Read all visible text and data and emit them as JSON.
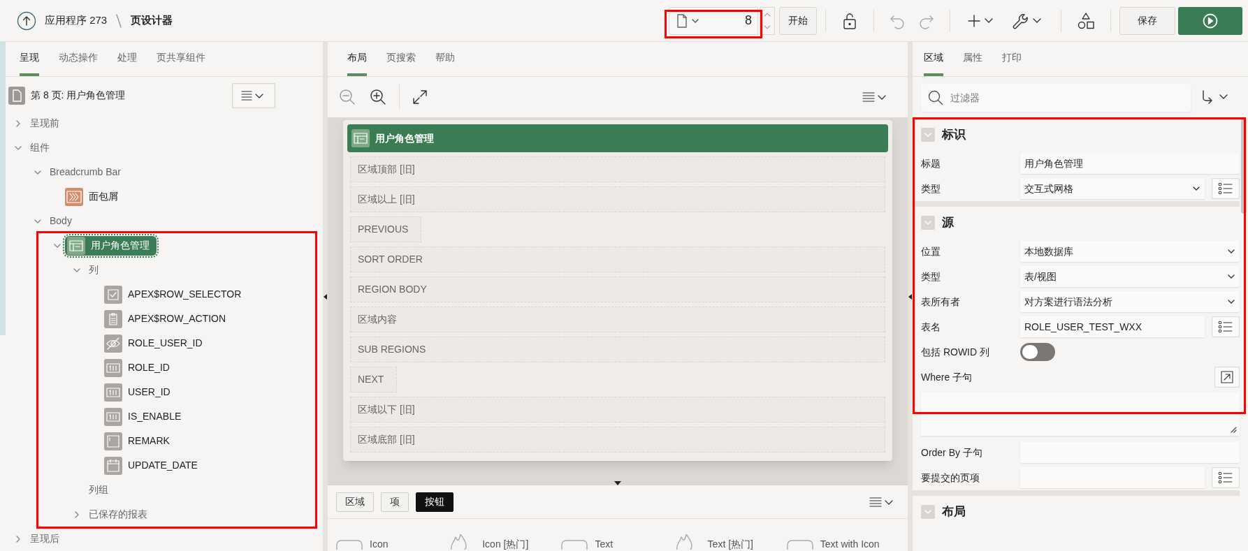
{
  "header": {
    "breadcrumb": [
      "应用程序 273",
      "页设计器"
    ],
    "page_selector": {
      "value": "8",
      "highlighted": true
    },
    "start_button": "开始",
    "save_button": "保存"
  },
  "left_panel": {
    "tabs": [
      {
        "label": "呈现",
        "selected": true
      },
      {
        "label": "动态操作",
        "selected": false
      },
      {
        "label": "处理",
        "selected": false
      },
      {
        "label": "页共享组件",
        "selected": false
      }
    ],
    "page_title": "第 8 页: 用户角色管理",
    "tree": [
      {
        "label": "呈现前",
        "expanded": false
      },
      {
        "label": "组件",
        "expanded": true,
        "children": [
          {
            "label": "Breadcrumb Bar",
            "expanded": true,
            "children": [
              {
                "label": "面包屑",
                "kind": "breadcrumb"
              }
            ]
          },
          {
            "label": "Body",
            "expanded": true,
            "children": [
              {
                "label": "用户角色管理",
                "kind": "region",
                "expanded": true,
                "selected": true,
                "highlighted": true,
                "children": [
                  {
                    "label": "列",
                    "expanded": true,
                    "children": [
                      {
                        "label": "APEX$ROW_SELECTOR",
                        "kind": "checkbox"
                      },
                      {
                        "label": "APEX$ROW_ACTION",
                        "kind": "action"
                      },
                      {
                        "label": "ROLE_USER_ID",
                        "kind": "hidden"
                      },
                      {
                        "label": "ROLE_ID",
                        "kind": "number"
                      },
                      {
                        "label": "USER_ID",
                        "kind": "number"
                      },
                      {
                        "label": "IS_ENABLE",
                        "kind": "number"
                      },
                      {
                        "label": "REMARK",
                        "kind": "text"
                      },
                      {
                        "label": "UPDATE_DATE",
                        "kind": "date"
                      }
                    ]
                  },
                  {
                    "label": "列组"
                  },
                  {
                    "label": "已保存的报表",
                    "expanded": false
                  }
                ]
              }
            ]
          }
        ]
      },
      {
        "label": "呈现后",
        "expanded": false
      }
    ]
  },
  "center_panel": {
    "tabs": [
      {
        "label": "布局",
        "selected": true
      },
      {
        "label": "页搜索",
        "selected": false
      },
      {
        "label": "帮助",
        "selected": false
      }
    ],
    "region_title": "用户角色管理",
    "slots": [
      {
        "label": "区域顶部 [旧]",
        "kind": "wide"
      },
      {
        "label": "区域以上 [旧]",
        "kind": "wide"
      },
      {
        "label": "PREVIOUS",
        "kind": "narrow"
      },
      {
        "label": "SORT ORDER",
        "kind": "wide"
      },
      {
        "label": "REGION BODY",
        "kind": "wide"
      },
      {
        "label": "区域内容",
        "kind": "wide"
      },
      {
        "label": "SUB REGIONS",
        "kind": "wide"
      },
      {
        "label": "NEXT",
        "kind": "narrow"
      },
      {
        "label": "区域以下 [旧]",
        "kind": "wide"
      },
      {
        "label": "区域底部 [旧]",
        "kind": "wide"
      }
    ],
    "gallery_tabs": [
      {
        "label": "区域",
        "selected": false
      },
      {
        "label": "项",
        "selected": false
      },
      {
        "label": "按钮",
        "selected": true
      }
    ],
    "gallery_items": [
      {
        "label": "Icon",
        "hot": false
      },
      {
        "label": "Icon [热门]",
        "hot": true
      },
      {
        "label": "Text",
        "hot": false
      },
      {
        "label": "Text [热门]",
        "hot": true
      },
      {
        "label": "Text with Icon",
        "hot": false
      }
    ]
  },
  "right_panel": {
    "tabs": [
      {
        "label": "区域",
        "selected": true
      },
      {
        "label": "属性",
        "selected": false
      },
      {
        "label": "打印",
        "selected": false
      }
    ],
    "filter": {
      "placeholder": "过滤器"
    },
    "sections": [
      {
        "title": "标识",
        "expanded": true,
        "properties": [
          {
            "label": "标题",
            "kind": "text",
            "value": "用户角色管理"
          },
          {
            "label": "类型",
            "kind": "select-lov",
            "value": "交互式网格"
          }
        ]
      },
      {
        "title": "源",
        "expanded": true,
        "properties": [
          {
            "label": "位置",
            "kind": "select",
            "value": "本地数据库"
          },
          {
            "label": "类型",
            "kind": "select",
            "value": "表/视图"
          },
          {
            "label": "表所有者",
            "kind": "select",
            "value": "对方案进行语法分析"
          },
          {
            "label": "表名",
            "kind": "text-lov",
            "value": "ROLE_USER_TEST_WXX"
          },
          {
            "label": "包括 ROWID 列",
            "kind": "switch",
            "on": false
          },
          {
            "label": "Where 子句",
            "kind": "code"
          },
          {
            "label": "Order By 子句",
            "kind": "text"
          },
          {
            "label": "要提交的页项",
            "kind": "text-lov"
          }
        ]
      },
      {
        "title": "布局",
        "expanded": true
      }
    ]
  }
}
